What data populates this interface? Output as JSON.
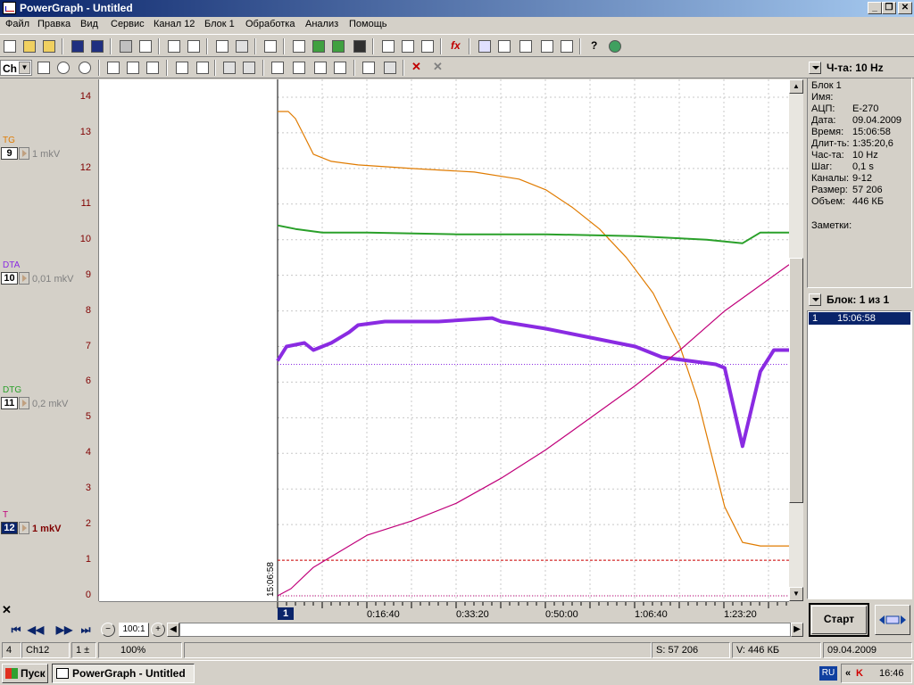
{
  "window": {
    "title": "PowerGraph - Untitled"
  },
  "menu": [
    "Файл",
    "Правка",
    "Вид",
    "Сервис",
    "Канал 12",
    "Блок 1",
    "Обработка",
    "Анализ",
    "Помощь"
  ],
  "toolbar2": {
    "channel_select": "Ch"
  },
  "channels": [
    {
      "name": "TG",
      "number": "9",
      "scale": "1 mkV",
      "color": "#e07b00"
    },
    {
      "name": "DTA",
      "number": "10",
      "scale": "0,01 mkV",
      "color": "#8a2be2"
    },
    {
      "name": "DTG",
      "number": "11",
      "scale": "0,2 mkV",
      "color": "#2aa02a"
    },
    {
      "name": "T",
      "number": "12",
      "scale": "1 mkV",
      "color": "#c0007a"
    }
  ],
  "y_axis": {
    "ticks": [
      "14",
      "13",
      "12",
      "11",
      "10",
      "9",
      "8",
      "7",
      "6",
      "5",
      "4",
      "3",
      "2",
      "1",
      "0"
    ]
  },
  "plot": {
    "start_time": "15:06:58",
    "block_marker": "1"
  },
  "time_axis": {
    "labels": [
      "0:16:40",
      "0:33:20",
      "0:50:00",
      "1:06:40",
      "1:23:20"
    ]
  },
  "hscroll": {
    "zoom_label": "100:1"
  },
  "statusbar": {
    "field1": "4",
    "field2": "Ch12",
    "field3": "1 ±",
    "zoom": "100%",
    "size": "S: 57 206",
    "volume": "V: 446 КБ",
    "date": "09.04.2009"
  },
  "right_panel": {
    "freq_header": "Ч-та: 10 Hz",
    "info": [
      {
        "k": "Блок 1",
        "v": ""
      },
      {
        "k": "Имя:",
        "v": ""
      },
      {
        "k": "АЦП:",
        "v": "E-270"
      },
      {
        "k": "Дата:",
        "v": "09.04.2009"
      },
      {
        "k": "Время:",
        "v": "15:06:58"
      },
      {
        "k": "Длит-ть:",
        "v": "1:35:20,6"
      },
      {
        "k": "Час-та:",
        "v": "10 Hz"
      },
      {
        "k": "Шаг:",
        "v": "0,1 s"
      },
      {
        "k": "Каналы:",
        "v": "9-12"
      },
      {
        "k": "Размер:",
        "v": "57 206"
      },
      {
        "k": "Объем:",
        "v": "446 КБ"
      }
    ],
    "notes_label": "Заметки:",
    "blocks_header": "Блок: 1 из 1",
    "block_row": {
      "num": "1",
      "time": "15:06:58"
    },
    "start_button": "Старт"
  },
  "taskbar": {
    "start": "Пуск",
    "app": "PowerGraph - Untitled",
    "lang": "RU",
    "clock": "16:46"
  },
  "chart_data": {
    "type": "line",
    "x_unit": "seconds since start",
    "xlim": [
      0,
      5720
    ],
    "ylim": [
      0,
      14
    ],
    "grid": true,
    "series": [
      {
        "name": "TG",
        "color": "#e07b00",
        "x": [
          0,
          120,
          200,
          300,
          400,
          600,
          900,
          1500,
          2200,
          2700,
          3000,
          3300,
          3600,
          3900,
          4200,
          4500,
          4700,
          4850,
          5000,
          5200,
          5400,
          5720
        ],
        "y": [
          13.6,
          13.6,
          13.4,
          12.9,
          12.4,
          12.2,
          12.1,
          12.0,
          11.9,
          11.7,
          11.4,
          10.9,
          10.3,
          9.5,
          8.5,
          7.0,
          5.5,
          4.0,
          2.5,
          1.5,
          1.4,
          1.4
        ]
      },
      {
        "name": "DTA",
        "color": "#8a2be2",
        "x": [
          0,
          100,
          300,
          400,
          600,
          800,
          900,
          1200,
          1800,
          2400,
          2500,
          3000,
          3600,
          4000,
          4300,
          4600,
          4900,
          5000,
          5200,
          5400,
          5550,
          5720
        ],
        "y": [
          6.6,
          7.0,
          7.1,
          6.9,
          7.1,
          7.4,
          7.6,
          7.7,
          7.7,
          7.8,
          7.7,
          7.5,
          7.2,
          7.0,
          6.7,
          6.6,
          6.5,
          6.4,
          4.2,
          6.3,
          6.9,
          6.9
        ]
      },
      {
        "name": "DTG",
        "color": "#2aa02a",
        "x": [
          0,
          200,
          500,
          1000,
          2000,
          3000,
          4000,
          4800,
          5200,
          5400,
          5720
        ],
        "y": [
          10.4,
          10.3,
          10.2,
          10.2,
          10.15,
          10.15,
          10.1,
          10.0,
          9.9,
          10.2,
          10.2
        ]
      },
      {
        "name": "T",
        "color": "#c0007a",
        "x": [
          0,
          150,
          400,
          800,
          1000,
          1500,
          2000,
          2500,
          3000,
          3500,
          4000,
          4500,
          5000,
          5720
        ],
        "y": [
          0.0,
          0.2,
          0.8,
          1.4,
          1.7,
          2.1,
          2.6,
          3.3,
          4.1,
          5.0,
          5.9,
          6.9,
          8.0,
          9.3
        ]
      }
    ],
    "reference_lines": [
      {
        "y": 6.5,
        "color": "#8a2be2",
        "style": "dotted"
      },
      {
        "y": 1.0,
        "color": "#d00000",
        "style": "dashed"
      }
    ]
  }
}
